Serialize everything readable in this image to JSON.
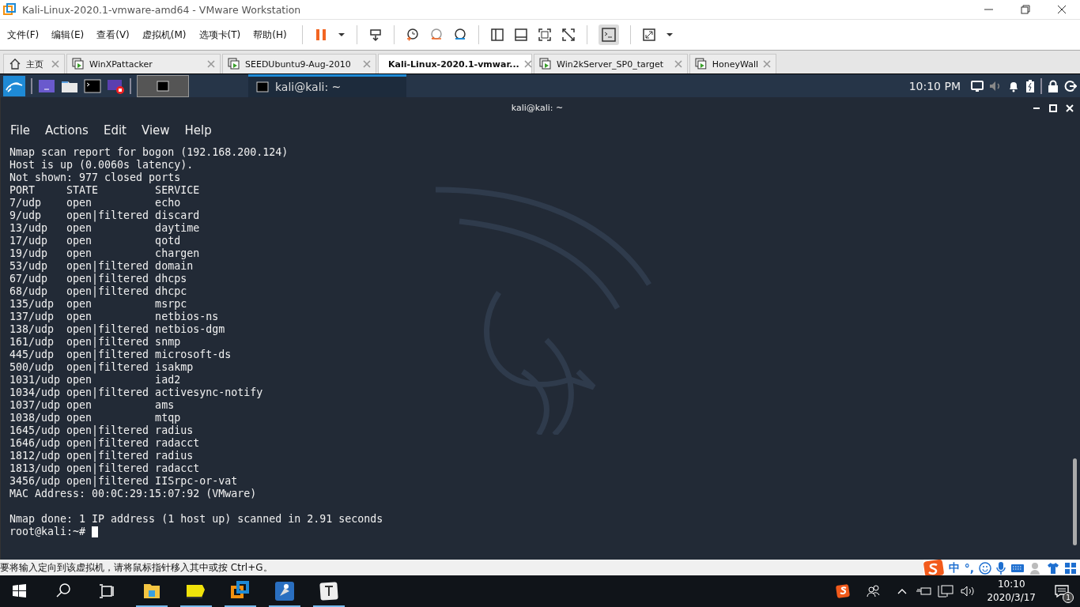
{
  "window": {
    "title": "Kali-Linux-2020.1-vmware-amd64 - VMware Workstation"
  },
  "menu": [
    "文件(F)",
    "编辑(E)",
    "查看(V)",
    "虚拟机(M)",
    "选项卡(T)",
    "帮助(H)"
  ],
  "tabs": [
    {
      "label": "主页",
      "kind": "home",
      "selected": false
    },
    {
      "label": "WinXPattacker",
      "kind": "vm",
      "selected": false
    },
    {
      "label": "SEEDUbuntu9-Aug-2010",
      "kind": "vm",
      "selected": false
    },
    {
      "label": "Kali-Linux-2020.1-vmwar...",
      "kind": "vm",
      "selected": true
    },
    {
      "label": "Win2kServer_SP0_target",
      "kind": "vm",
      "selected": false
    },
    {
      "label": "HoneyWall",
      "kind": "vm",
      "selected": false
    }
  ],
  "kali_panel": {
    "window_button": "kali@kali: ~",
    "clock": "10:10 PM"
  },
  "terminal": {
    "title": "kali@kali: ~",
    "menu": [
      "File",
      "Actions",
      "Edit",
      "View",
      "Help"
    ],
    "lines": [
      "Nmap scan report for bogon (192.168.200.124)",
      "Host is up (0.0060s latency).",
      "Not shown: 977 closed ports",
      "PORT     STATE         SERVICE",
      "7/udp    open          echo",
      "9/udp    open|filtered discard",
      "13/udp   open          daytime",
      "17/udp   open          qotd",
      "19/udp   open          chargen",
      "53/udp   open|filtered domain",
      "67/udp   open|filtered dhcps",
      "68/udp   open|filtered dhcpc",
      "135/udp  open          msrpc",
      "137/udp  open          netbios-ns",
      "138/udp  open|filtered netbios-dgm",
      "161/udp  open|filtered snmp",
      "445/udp  open|filtered microsoft-ds",
      "500/udp  open|filtered isakmp",
      "1031/udp open          iad2",
      "1034/udp open|filtered activesync-notify",
      "1037/udp open          ams",
      "1038/udp open          mtqp",
      "1645/udp open|filtered radius",
      "1646/udp open|filtered radacct",
      "1812/udp open|filtered radius",
      "1813/udp open|filtered radacct",
      "3456/udp open|filtered IISrpc-or-vat",
      "MAC Address: 00:0C:29:15:07:92 (VMware)"
    ],
    "summary": "Nmap done: 1 IP address (1 host up) scanned in 2.91 seconds",
    "prompt": "root@kali:~#"
  },
  "status_bar": {
    "message": "要将输入定向到该虚拟机，请将鼠标指针移入其中或按 Ctrl+G。"
  },
  "ime_toolbar": {
    "labels": [
      "中",
      "°,"
    ]
  },
  "taskbar": {
    "time": "10:10",
    "date": "2020/3/17",
    "notification_count": "1"
  }
}
